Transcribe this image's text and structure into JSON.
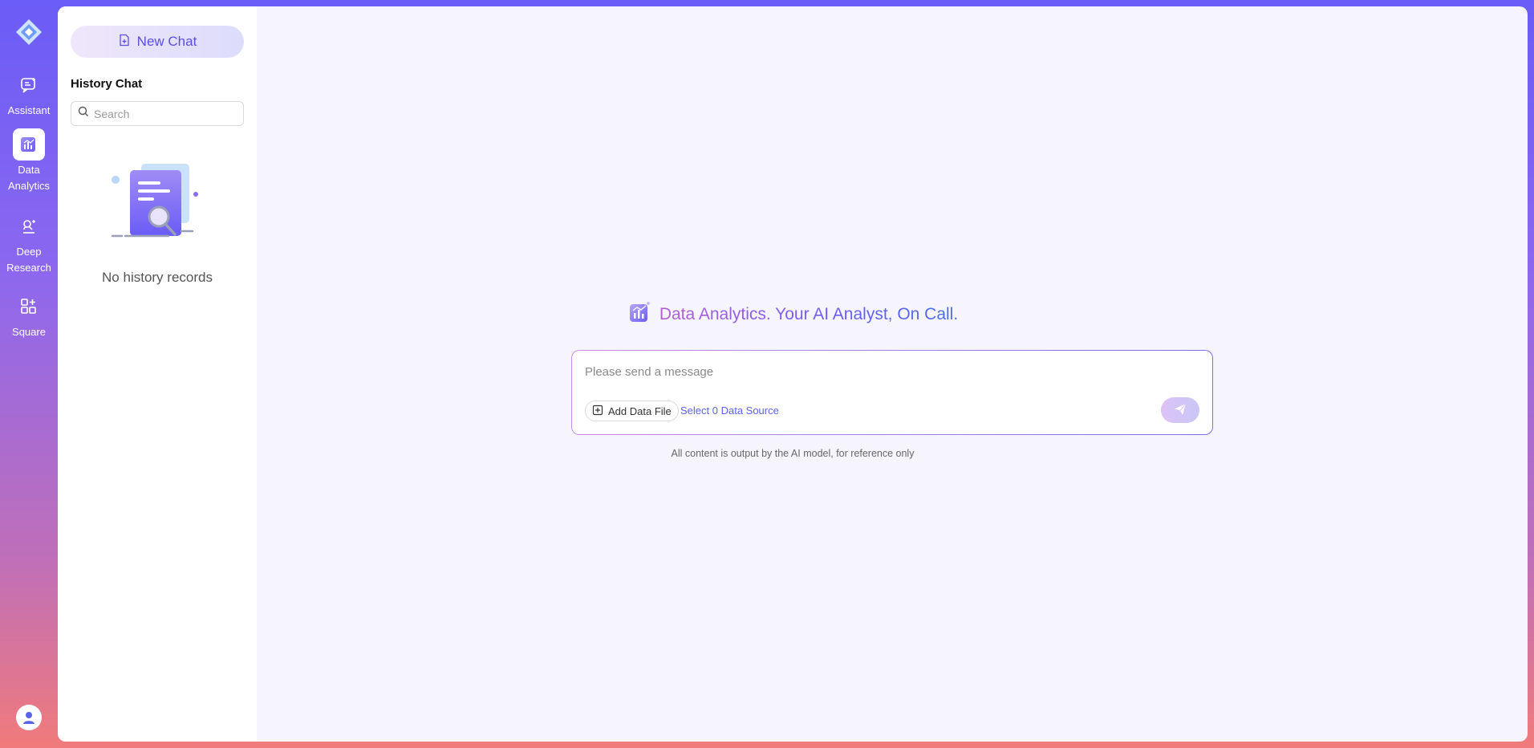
{
  "nav": {
    "items": [
      {
        "label": "Assistant",
        "icon": "chat-sparkle-icon"
      },
      {
        "label": "Data\nAnalytics",
        "icon": "data-analytics-icon",
        "active": true
      },
      {
        "label": "Deep\nResearch",
        "icon": "microscope-icon"
      },
      {
        "label": "Square",
        "icon": "apps-grid-icon"
      }
    ]
  },
  "sidebar": {
    "new_chat_label": "New Chat",
    "history_title": "History Chat",
    "search_placeholder": "Search",
    "empty_text": "No history records"
  },
  "main": {
    "hero_text": "Data Analytics. Your AI Analyst, On Call.",
    "composer": {
      "placeholder": "Please send a message",
      "add_file_label": "Add Data File",
      "data_source_label": "Select 0 Data Source"
    },
    "disclaimer": "All content is output by the AI model, for reference only"
  },
  "colors": {
    "accent": "#6a5cf6",
    "link": "#5b63e6",
    "gradient_top": "#6a5cf6",
    "gradient_bottom": "#f07b7b"
  }
}
